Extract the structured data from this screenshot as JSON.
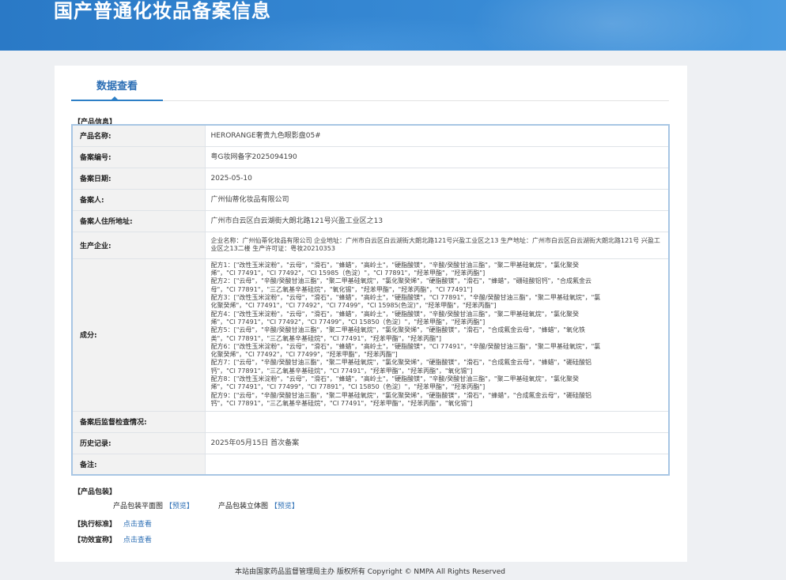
{
  "banner": {
    "title": "国产普通化妆品备案信息"
  },
  "tab": {
    "label": "数据查看"
  },
  "product_section": {
    "heading": "【产品信息】"
  },
  "rows": {
    "product_name": {
      "label": "产品名称:",
      "value": "HERORANGE奢贵九色眼影盘05#"
    },
    "record_no": {
      "label": "备案编号:",
      "value": "粤G妆网备字2025094190"
    },
    "record_date": {
      "label": "备案日期:",
      "value": "2025-05-10"
    },
    "registrant": {
      "label": "备案人:",
      "value": "广州仙蒂化妆品有限公司"
    },
    "registrant_address": {
      "label": "备案人住所地址:",
      "value": "广州市白云区白云湖街大朗北路121号兴盈工业区之13"
    },
    "manufacturer": {
      "label": "生产企业:",
      "value": "企业名称：广州仙蒂化妆品有限公司 企业地址：广州市白云区白云湖街大朗北路121号兴盈工业区之13 生产地址：广州市白云区白云湖街大朗北路121号 兴盈工业区之13二楼 生产许可证：粤妆20210353"
    },
    "ingredients": {
      "label": "成分:",
      "lines": [
        "配方1：[\"改性玉米淀粉\"，\"云母\"，\"滑石\"，\"蜂蜡\"，\"高岭土\"，\"硬脂酸镁\"，\"辛酸/癸酸甘油三酯\"，\"聚二甲基硅氧烷\"，\"氯化聚癸",
        "烯\"，\"CI 77491\"，\"CI 77492\"，\"CI 15985（色淀）\"，\"CI 77891\"，\"羟苯甲酯\"，\"羟苯丙酯\"]",
        "配方2：[\"云母\"，\"辛酸/癸酸甘油三酯\"，\"聚二甲基硅氧烷\"，\"氯化聚癸烯\"，\"硬脂酸镁\"，\"滑石\"，\"蜂蜡\"，\"硼硅酸铝钙\"，\"合成氟金云",
        "母\"，\"CI 77891\"，\"三乙氧基辛基硅烷\"，\"氧化锡\"，\"羟苯甲酯\"，\"羟苯丙酯\"，\"CI 77491\"]",
        "配方3：[\"改性玉米淀粉\"，\"云母\"，\"滑石\"，\"蜂蜡\"，\"高岭土\"，\"硬脂酸镁\"，\"CI 77891\"，\"辛酸/癸酸甘油三酯\"，\"聚二甲基硅氧烷\"，\"氯",
        "化聚癸烯\"，\"CI 77491\"，\"CI 77492\"，\"CI 77499\"，\"CI 15985(色淀)\"，\"羟苯甲酯\"，\"羟苯丙酯\"]",
        "配方4：[\"改性玉米淀粉\"，\"云母\"，\"滑石\"，\"蜂蜡\"，\"高岭土\"，\"硬脂酸镁\"，\"辛酸/癸酸甘油三酯\"，\"聚二甲基硅氧烷\"，\"氯化聚癸",
        "烯\"，\"CI 77491\"，\"CI 77492\"，\"CI 77499\"，\"CI 15850（色淀）\"，\"羟苯甲酯\"，\"羟苯丙酯\"]",
        "配方5：[\"云母\"，\"辛酸/癸酸甘油三酯\"，\"聚二甲基硅氧烷\"，\"氯化聚癸烯\"，\"硬脂酸镁\"，\"滑石\"，\"合成氟金云母\"，\"蜂蜡\"，\"氧化铁",
        "类\"，\"CI 77891\"，\"三乙氧基辛基硅烷\"，\"CI 77491\"，\"羟苯甲酯\"，\"羟苯丙酯\"]",
        "配方6：[\"改性玉米淀粉\"，\"云母\"，\"滑石\"，\"蜂蜡\"，\"高岭土\"，\"硬脂酸镁\"，\"CI 77491\"，\"辛酸/癸酸甘油三酯\"，\"聚二甲基硅氧烷\"，\"氯",
        "化聚癸烯\"，\"CI 77492\"，\"CI 77499\"，\"羟苯甲酯\"，\"羟苯丙酯\"]",
        "配方7：[\"云母\"，\"辛酸/癸酸甘油三酯\"，\"聚二甲基硅氧烷\"，\"氯化聚癸烯\"，\"硬脂酸镁\"，\"滑石\"，\"合成氟金云母\"，\"蜂蜡\"，\"硼硅酸铝",
        "钙\"，\"CI 77891\"，\"三乙氧基辛基硅烷\"，\"CI 77491\"，\"羟苯甲酯\"，\"羟苯丙酯\"，\"氧化锡\"]",
        "配方8：[\"改性玉米淀粉\"，\"云母\"，\"滑石\"，\"蜂蜡\"，\"高岭土\"，\"硬脂酸镁\"，\"辛酸/癸酸甘油三酯\"，\"聚二甲基硅氧烷\"，\"氯化聚癸",
        "烯\"，\"CI 77491\"，\"CI 77499\"，\"CI 77891\"，\"CI 15850（色淀）\"，\"羟苯甲酯\"，\"羟苯丙酯\"]",
        "配方9：[\"云母\"，\"辛酸/癸酸甘油三酯\"，\"聚二甲基硅氧烷\"，\"氯化聚癸烯\"，\"硬脂酸镁\"，\"滑石\"，\"蜂蜡\"，\"合成氟金云母\"，\"硼硅酸铝",
        "钙\"，\"CI 77891\"，\"三乙氧基辛基硅烷\"，\"CI 77491\"，\"羟苯甲酯\"，\"羟苯丙酯\"，\"氧化锡\"]"
      ]
    },
    "inspection": {
      "label": "备案后监督检查情况:",
      "value": ""
    },
    "history": {
      "label": "历史记录:",
      "value": "2025年05月15日 首次备案"
    },
    "notes": {
      "label": "备注:",
      "value": ""
    }
  },
  "packaging": {
    "heading": "【产品包装】",
    "flat_label": "产品包装平面图",
    "flat_link": "【预览】",
    "solid_label": "产品包装立体图",
    "solid_link": "【预览】"
  },
  "standard": {
    "label": "【执行标准】",
    "link": "点击查看"
  },
  "efficacy": {
    "label": "【功效宣称】",
    "link": "点击查看"
  },
  "footer": {
    "text": "本站由国家药品监督管理局主办 版权所有 Copyright © NMPA All Rights Reserved"
  }
}
